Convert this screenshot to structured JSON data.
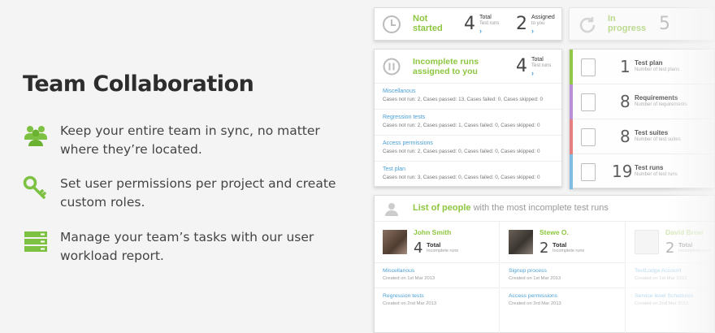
{
  "headline": "Team Collaboration",
  "features": [
    {
      "icon": "users-icon",
      "text": "Keep your entire team in sync, no matter where they’re located."
    },
    {
      "icon": "key-icon",
      "text": "Set user permissions per project and create custom roles."
    },
    {
      "icon": "server-icon",
      "text": "Manage your team’s tasks with our user workload report."
    }
  ],
  "status_card": {
    "title_line1": "Not",
    "title_line2": "started",
    "total_num": "4",
    "total_lbl": "Total",
    "total_sub": "Test runs",
    "assigned_num": "2",
    "assigned_lbl": "Assigned",
    "assigned_sub": "to you"
  },
  "progress_card": {
    "title_line1": "In",
    "title_line2": "progress",
    "num": "5"
  },
  "incomplete": {
    "title_line1": "Incomplete runs",
    "title_line2": "assigned to you",
    "num": "4",
    "lbl": "Total",
    "sub": "Test runs",
    "rows": [
      {
        "title": "Miscellanous",
        "detail": "Cases not run: 2, Cases passed: 13, Cases failed: 0, Cases skipped: 0"
      },
      {
        "title": "Regression tests",
        "detail": "Cases not run: 2, Cases passed: 1, Cases failed: 0, Cases skipped: 0"
      },
      {
        "title": "Access permissions",
        "detail": "Cases not run: 2, Cases passed: 0, Cases failed: 0, Cases skipped: 0"
      },
      {
        "title": "Test plan",
        "detail": "Cases not run: 3, Cases passed: 0, Cases failed: 0, Cases skipped: 0"
      }
    ]
  },
  "stats": [
    {
      "num": "1",
      "label": "Test plan",
      "sub": "Number of test plans",
      "color": "#8dc63f"
    },
    {
      "num": "8",
      "label": "Requirements",
      "sub": "Number of requirements",
      "color": "#b88ad6"
    },
    {
      "num": "8",
      "label": "Test suites",
      "sub": "Number of test suites",
      "color": "#e57a7a"
    },
    {
      "num": "19",
      "label": "Test runs",
      "sub": "Number of test runs",
      "color": "#7ab8e0"
    }
  ],
  "people": {
    "title": "List of people",
    "title_rest": "with the most incomplete test runs",
    "list": [
      {
        "name": "John Smith",
        "num": "4",
        "lbl": "Total",
        "sub": "Incomplete runs",
        "rows": [
          {
            "title": "Miscellanous",
            "detail": "Created on 1st Mar 2013"
          },
          {
            "title": "Regression tests",
            "detail": "Created on 2nd Mar 2013"
          }
        ]
      },
      {
        "name": "Stewe O.",
        "num": "2",
        "lbl": "Total",
        "sub": "Incomplete runs",
        "rows": [
          {
            "title": "Signup process",
            "detail": "Created on 1st Mar 2013"
          },
          {
            "title": "Access permissions",
            "detail": "Created on 3rd Mar 2013"
          }
        ]
      },
      {
        "name": "David Brow",
        "num": "2",
        "lbl": "Total",
        "sub": "Incomplete runs",
        "rows": [
          {
            "title": "TestLodge Account",
            "detail": "Created on 1st Mar 2013"
          },
          {
            "title": "Service level Schedules",
            "detail": "Created on 2nd Mar 2013"
          }
        ]
      }
    ]
  }
}
